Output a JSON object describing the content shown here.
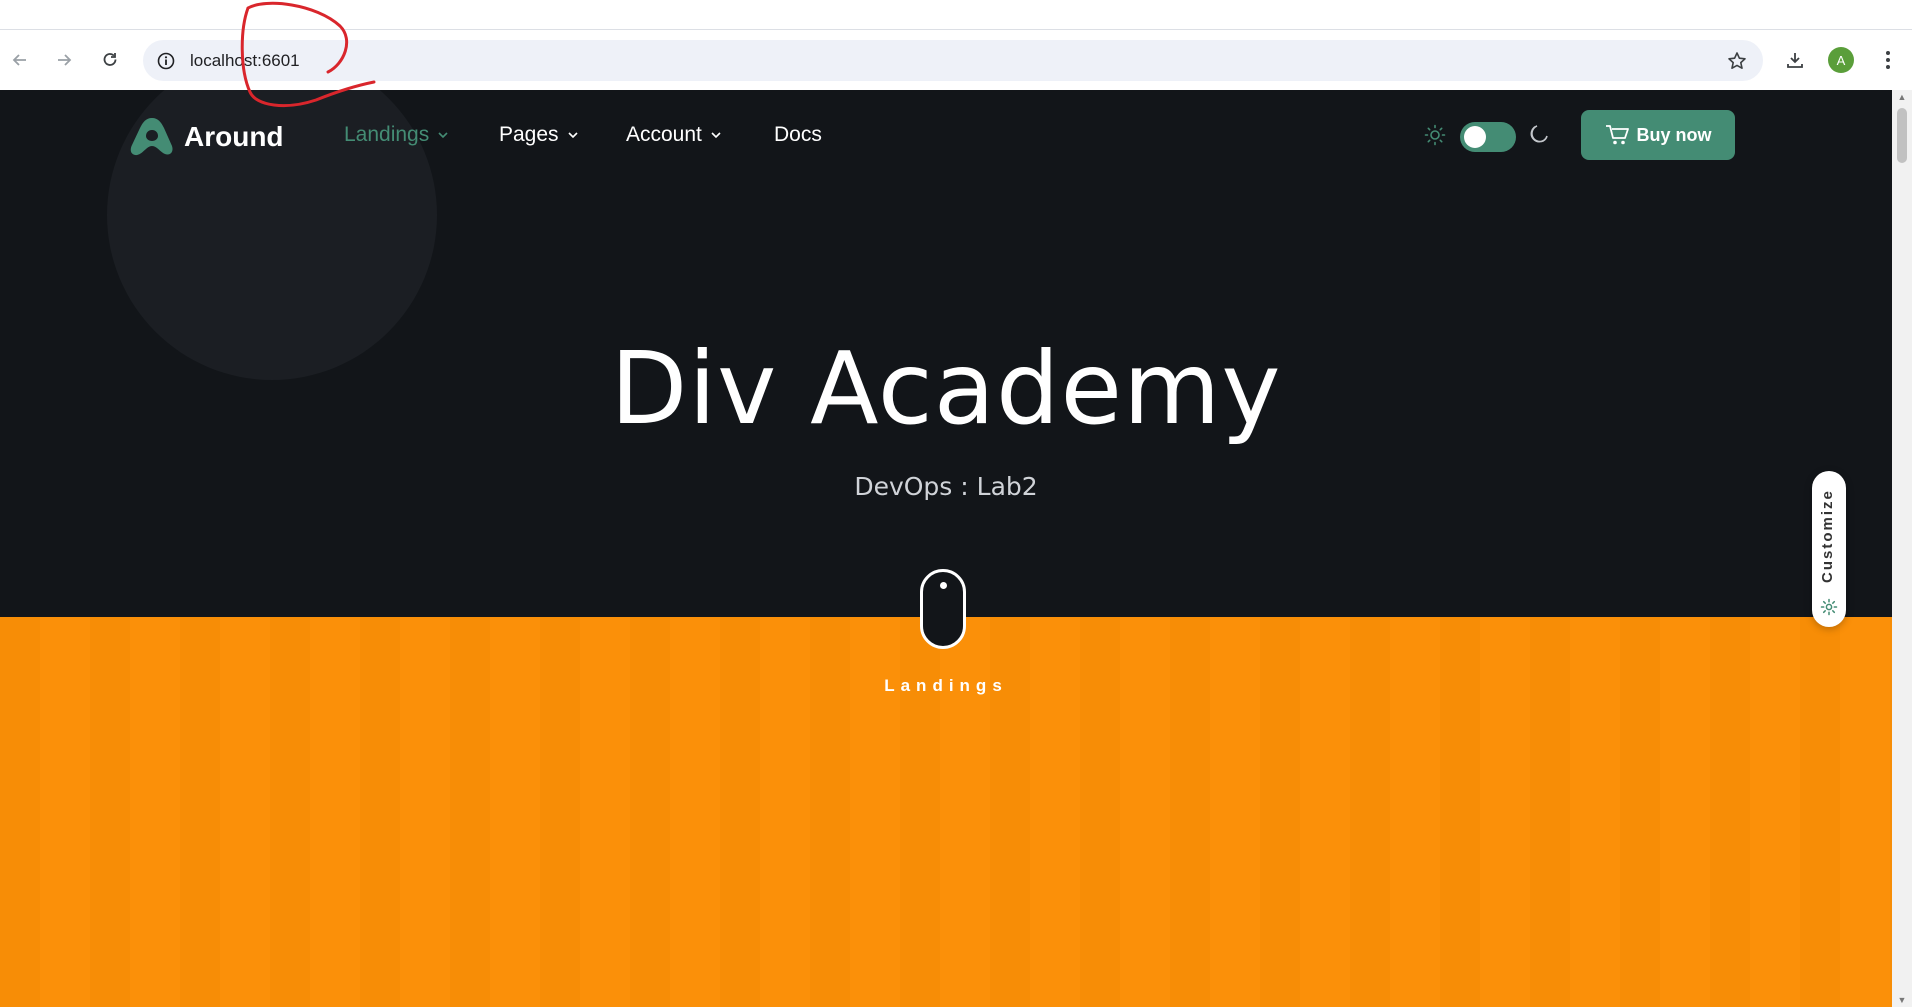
{
  "browser": {
    "url": "localhost:6601",
    "profile_initial": "A"
  },
  "site": {
    "brand": "Around",
    "nav": [
      {
        "label": "Landings",
        "dropdown": true,
        "active": true
      },
      {
        "label": "Pages",
        "dropdown": true,
        "active": false
      },
      {
        "label": "Account",
        "dropdown": true,
        "active": false
      },
      {
        "label": "Docs",
        "dropdown": false,
        "active": false
      }
    ],
    "buy_label": "Buy now",
    "hero_title": "Div Academy",
    "hero_subtitle": "DevOps : Lab2",
    "scroll_label": "Landings",
    "customize_label": "Customize"
  },
  "colors": {
    "accent": "#448c74",
    "dark_bg": "#121519",
    "orange_bg": "#fb8f06",
    "annotation": "#d9262c"
  }
}
